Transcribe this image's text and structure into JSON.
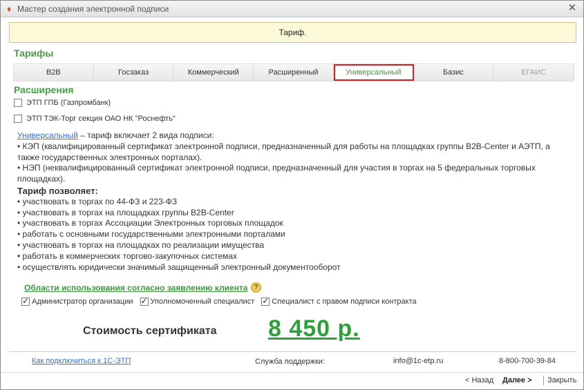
{
  "window": {
    "title": "Мастер создания электронной подписи",
    "close_glyph": "✕",
    "app_icon_glyph": "♦"
  },
  "banner": {
    "text": "Тариф."
  },
  "tariffs": {
    "title": "Тарифы",
    "tabs": [
      {
        "label": "B2B"
      },
      {
        "label": "Госзаказ"
      },
      {
        "label": "Коммерческий"
      },
      {
        "label": "Расширенный"
      },
      {
        "label": "Универсальный",
        "selected": true
      },
      {
        "label": "Базис"
      },
      {
        "label": "ЕГАИС",
        "disabled": true
      }
    ]
  },
  "extensions": {
    "title": "Расширения",
    "items": [
      {
        "label": "ЭТП ГПБ (Газпромбанк)",
        "checked": false
      },
      {
        "label": "ЭТП ТЭК-Торг секция ОАО НК \"Роснефть\"",
        "checked": false
      }
    ]
  },
  "description": {
    "tariff_link": "Универсальный",
    "intro": " – тариф включает 2 вида подписи:",
    "line1": "• КЭП (квалифицированный сертификат электронной подписи, предназначенный для работы на площадках группы B2B-Center и АЭТП, а также государственных электронных порталах).",
    "line2": "• НЭП (неквалифицированный сертификат электронной подписи, предназначенный для участия в торгах на 5 федеральных торговых площадках).",
    "allows_title": "Тариф позволяет:",
    "allows": [
      "• участвовать в торгах по 44-ФЗ и 223-ФЗ",
      "• участвовать в торгах на площадках группы B2B-Center",
      "• участвовать в торгах Ассоциации Электронных торговых площадок",
      "• работать с основными государственными электронными порталами",
      "• участвовать в торгах на площадках по реализации имущества",
      "• работать в коммерческих торгово-закупочных системах",
      "• осуществлять юридически значимый защищенный электронный документооборот"
    ]
  },
  "usage": {
    "title": "Области использования согласно заявлению клиента",
    "help_glyph": "?",
    "roles": [
      {
        "label": "Администратор организации",
        "checked": true
      },
      {
        "label": "Уполномоченный специалист",
        "checked": true
      },
      {
        "label": "Специалист с правом подписи контракта",
        "checked": true
      }
    ]
  },
  "cost": {
    "label": "Стоимость сертификата",
    "value": "8 450 р."
  },
  "footer": {
    "connect_link": "Как подключиться к 1С-ЭТП",
    "support_label": "Служба поддержки:",
    "email": "info@1c-etp.ru",
    "phone": "8-800-700-39-84"
  },
  "nav": {
    "back": "< Назад",
    "next": "Далее >",
    "close": "Закрыть"
  }
}
